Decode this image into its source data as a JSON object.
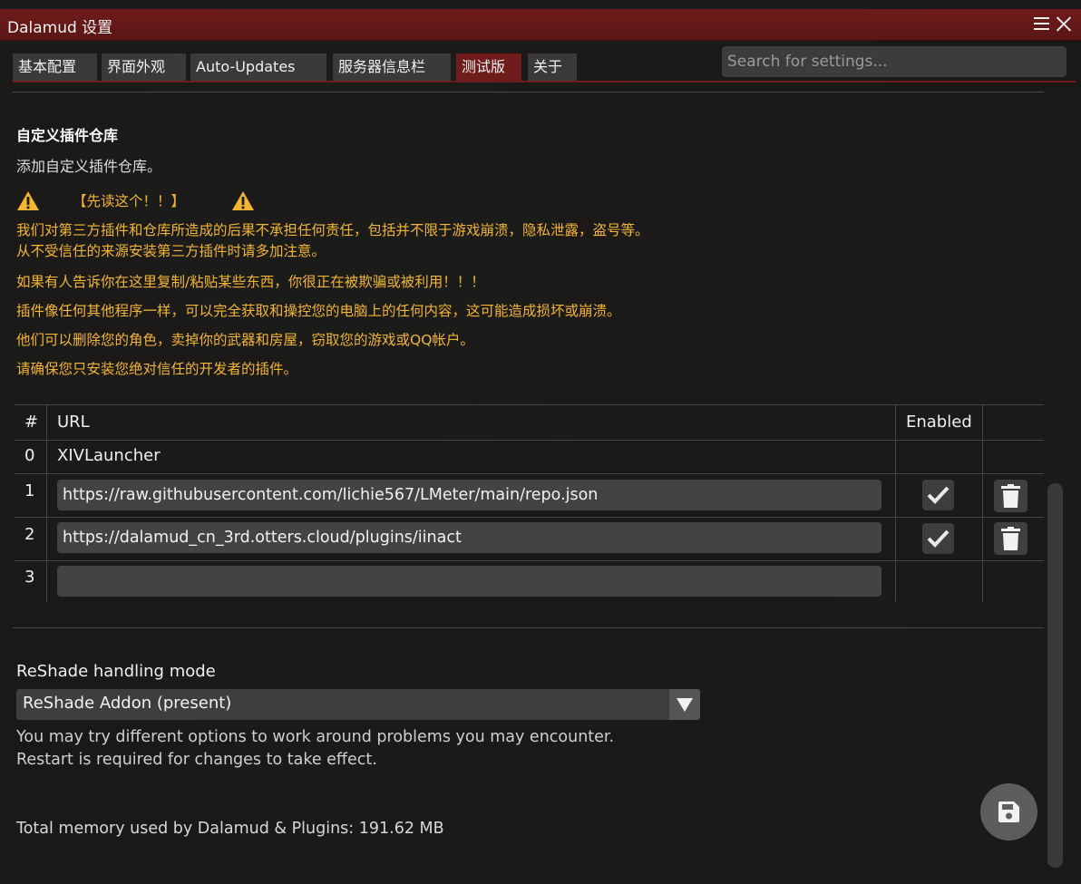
{
  "window": {
    "title": "Dalamud 设置"
  },
  "tabs": [
    {
      "label": "基本配置"
    },
    {
      "label": "界面外观"
    },
    {
      "label": "Auto-Updates"
    },
    {
      "label": "服务器信息栏"
    },
    {
      "label": "测试版",
      "active": true
    },
    {
      "label": "关于"
    }
  ],
  "search": {
    "placeholder": "Search for settings..."
  },
  "repo_section": {
    "title": "自定义插件仓库",
    "description": "添加自定义插件仓库。",
    "warning_header": "【先读这个！！】",
    "warning_lines": [
      "我们对第三方插件和仓库所造成的后果不承担任何责任，包括并不限于游戏崩溃，隐私泄露，盗号等。",
      "从不受信任的来源安装第三方插件时请多加注意。",
      "如果有人告诉你在这里复制/粘贴某些东西，你很正在被欺骗或被利用！！！",
      "插件像任何其他程序一样，可以完全获取和操控您的电脑上的任何内容，这可能造成损坏或崩溃。",
      "他们可以删除您的角色，卖掉你的武器和房屋，窃取您的游戏或QQ帐户。",
      "请确保您只安装您绝对信任的开发者的插件。"
    ],
    "table": {
      "headers": {
        "index": "#",
        "url": "URL",
        "enabled": "Enabled"
      },
      "rows": [
        {
          "index": "0",
          "url": "XIVLauncher"
        },
        {
          "index": "1",
          "url": "https://raw.githubusercontent.com/lichie567/LMeter/main/repo.json",
          "enabled": true
        },
        {
          "index": "2",
          "url": "https://dalamud_cn_3rd.otters.cloud/plugins/iinact",
          "enabled": true
        },
        {
          "index": "3",
          "url": ""
        }
      ]
    }
  },
  "reshade": {
    "label": "ReShade handling mode",
    "selected": "ReShade Addon (present)",
    "hint_lines": [
      "You may try different options to work around problems you may encounter.",
      "Restart is required for changes to take effect."
    ]
  },
  "footer": {
    "memory": "Total memory used by Dalamud & Plugins: 191.62 MB"
  },
  "colors": {
    "accent": "#6e1c1c",
    "warning": "#f3b531"
  }
}
